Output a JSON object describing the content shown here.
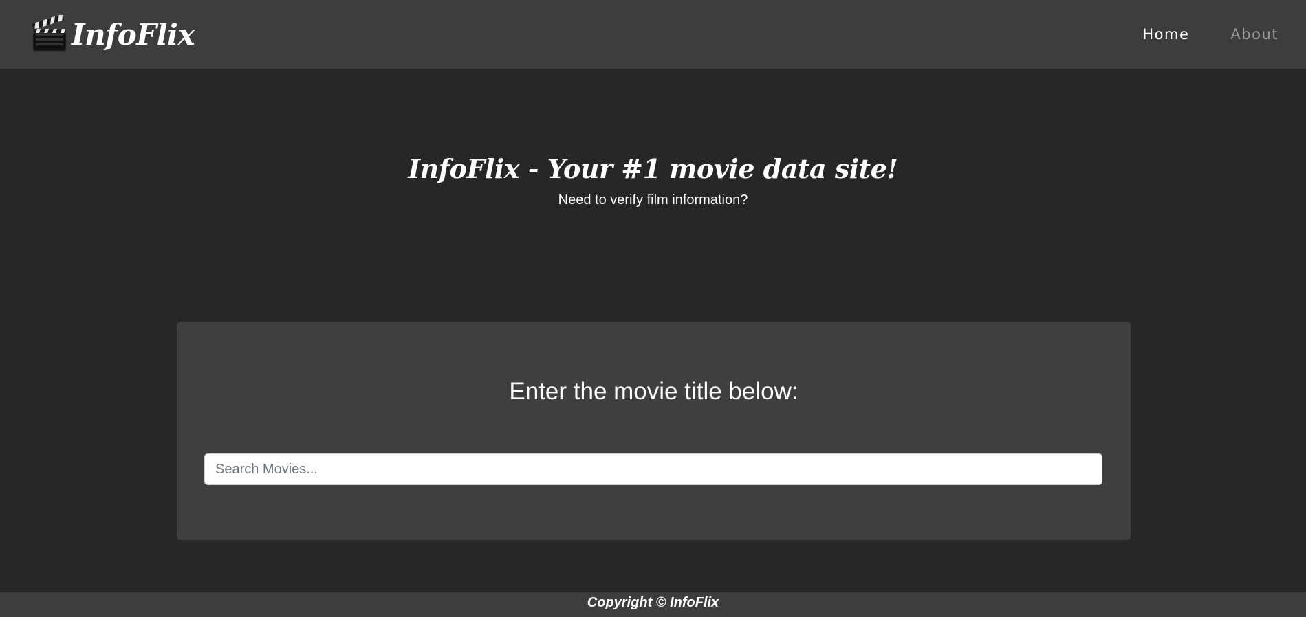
{
  "navbar": {
    "brand_name": "InfoFlix",
    "logo_icon": "clapperboard-icon",
    "links": [
      {
        "label": "Home",
        "active": true
      },
      {
        "label": "About",
        "active": false
      }
    ]
  },
  "hero": {
    "title": "InfoFlix - Your #1 movie data site!",
    "subtitle": "Need to verify film information?"
  },
  "search": {
    "heading": "Enter the movie title below:",
    "placeholder": "Search Movies...",
    "value": ""
  },
  "footer": {
    "copyright": "Copyright © InfoFlix"
  },
  "colors": {
    "background": "#272727",
    "navbar": "#3d3d3d",
    "card": "#3f3f3f",
    "text": "#ffffff",
    "nav_inactive": "#9a9a9a"
  }
}
